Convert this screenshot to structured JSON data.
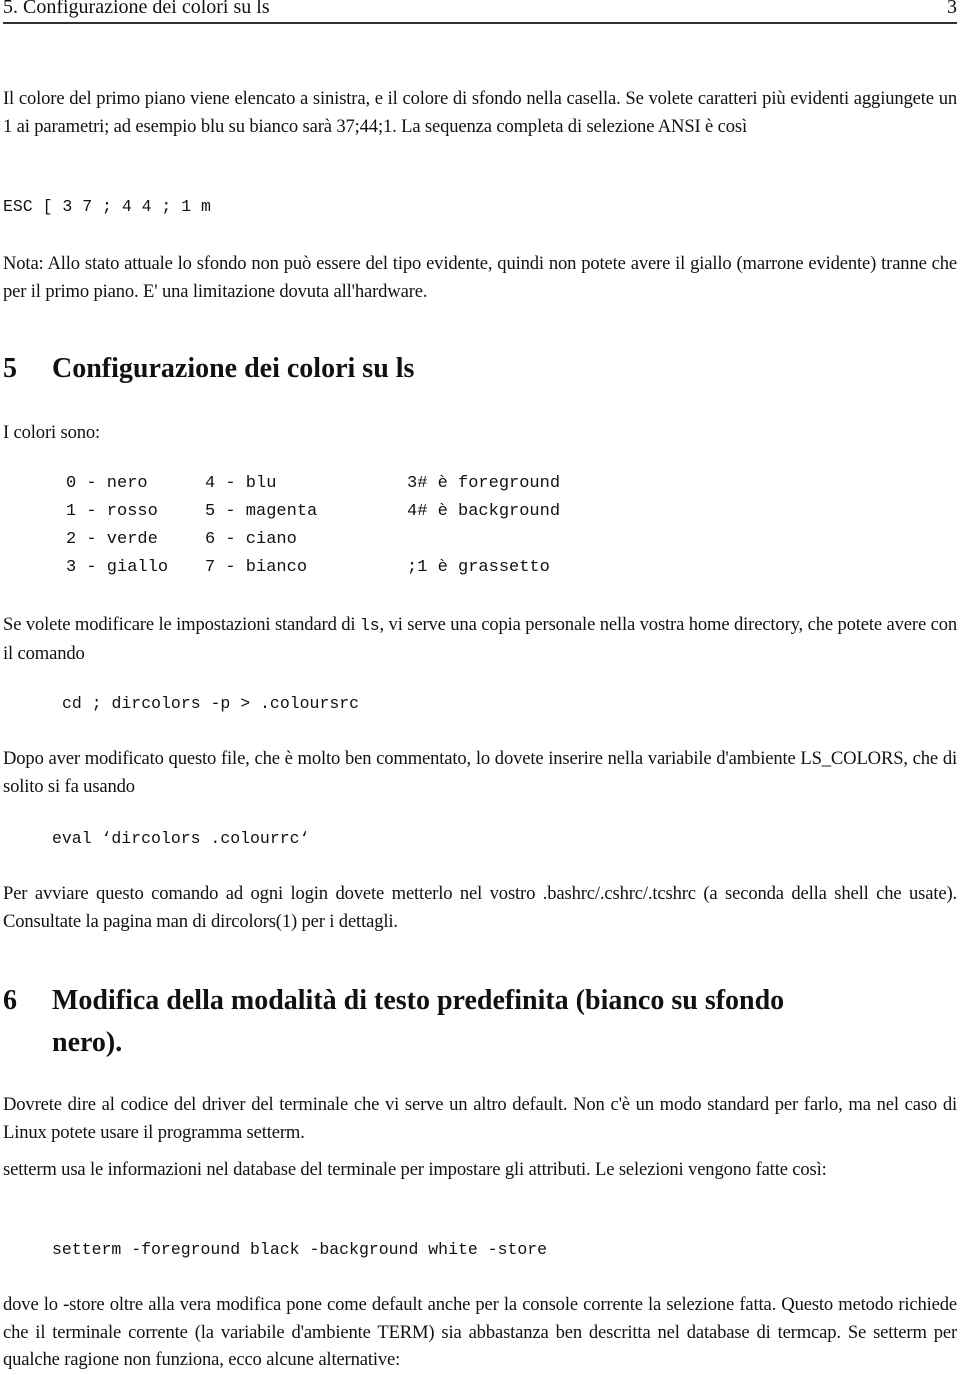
{
  "header": {
    "running_title": "5.  Configurazione dei colori su ls",
    "page_number": "3"
  },
  "intro": {
    "paragraph1": "Il colore del primo piano viene elencato a sinistra, e il colore di sfondo nella casella.  Se volete caratteri più evidenti aggiungete un 1 ai parametri; ad esempio blu su bianco sarà 37;44;1. La sequenza completa di selezione ANSI è così",
    "ansi_sequence": "ESC [ 3 7 ; 4 4 ; 1 m",
    "note": "Nota: Allo stato attuale lo sfondo non può essere del tipo evidente, quindi non potete avere il giallo (marrone evidente) tranne che per il primo piano. E' una limitazione dovuta all'hardware."
  },
  "section5": {
    "number": "5",
    "title": "Configurazione dei colori su ls",
    "colors_intro": "I colori sono:",
    "colors_table": {
      "col1": [
        "0 - nero",
        "1 - rosso",
        "2 - verde",
        "3 - giallo"
      ],
      "col2": [
        "4 - blu",
        "5 - magenta",
        "6 - ciano",
        "7 - bianco"
      ],
      "col3": [
        "3# è foreground",
        "4# è background",
        "",
        ";1 è grassetto"
      ]
    },
    "para_ls_before": "Se volete modificare le impostazioni standard di ",
    "para_ls_code": "ls",
    "para_ls_after": ", vi serve una copia personale nella vostra home directory, che potete avere con il comando",
    "cmd_dircolors": "cd ; dircolors -p > .coloursrc",
    "para_after_edit": "Dopo aver modificato questo file, che è molto ben commentato, lo dovete inserire nella variabile d'ambiente LS_COLORS, che di solito si fa usando",
    "cmd_eval": "eval ‘dircolors .colourrc‘",
    "para_login": "Per avviare questo comando ad ogni login dovete metterlo nel vostro .bashrc/.cshrc/.tcshrc (a seconda della shell che usate). Consultate la pagina man di dircolors(1) per i dettagli."
  },
  "section6": {
    "number": "6",
    "title_line1": "Modifica della modalità di testo predefinita (bianco su sfondo",
    "title_line2": "nero).",
    "para_driver": "Dovrete dire al codice del driver del terminale che vi serve un altro default. Non c'è un modo standard per farlo, ma nel caso di Linux potete usare il programma setterm.",
    "para_setterm": "setterm usa le informazioni nel database del terminale per impostare gli attributi. Le selezioni vengono fatte così:",
    "cmd_setterm": "setterm -foreground black -background white -store",
    "para_store": "dove lo -store oltre alla vera modifica pone come default anche per la console corrente la selezione fatta. Questo metodo richiede che il terminale corrente (la variabile d'ambiente TERM) sia abbastanza ben descritta nel database di termcap. Se setterm per qualche ragione non funziona, ecco alcune alternative:"
  }
}
